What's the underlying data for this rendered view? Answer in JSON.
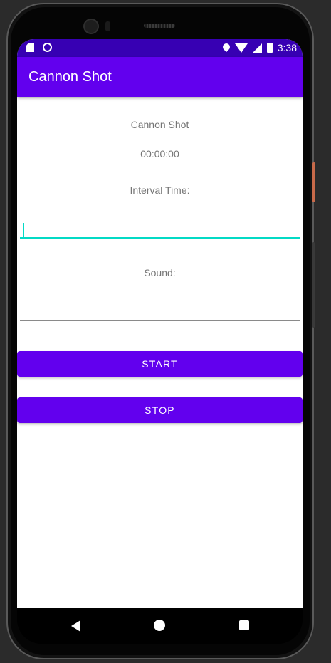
{
  "statusbar": {
    "time": "3:38"
  },
  "appbar": {
    "title": "Cannon Shot"
  },
  "main": {
    "heading": "Cannon Shot",
    "timer": "00:00:00",
    "interval_label": "Interval Time:",
    "interval_value": "",
    "sound_label": "Sound:",
    "sound_value": "",
    "start_label": "START",
    "stop_label": "STOP"
  },
  "colors": {
    "primary": "#6200ee",
    "primary_dark": "#3700b3",
    "accent": "#03dac5",
    "text_secondary": "#757575"
  }
}
